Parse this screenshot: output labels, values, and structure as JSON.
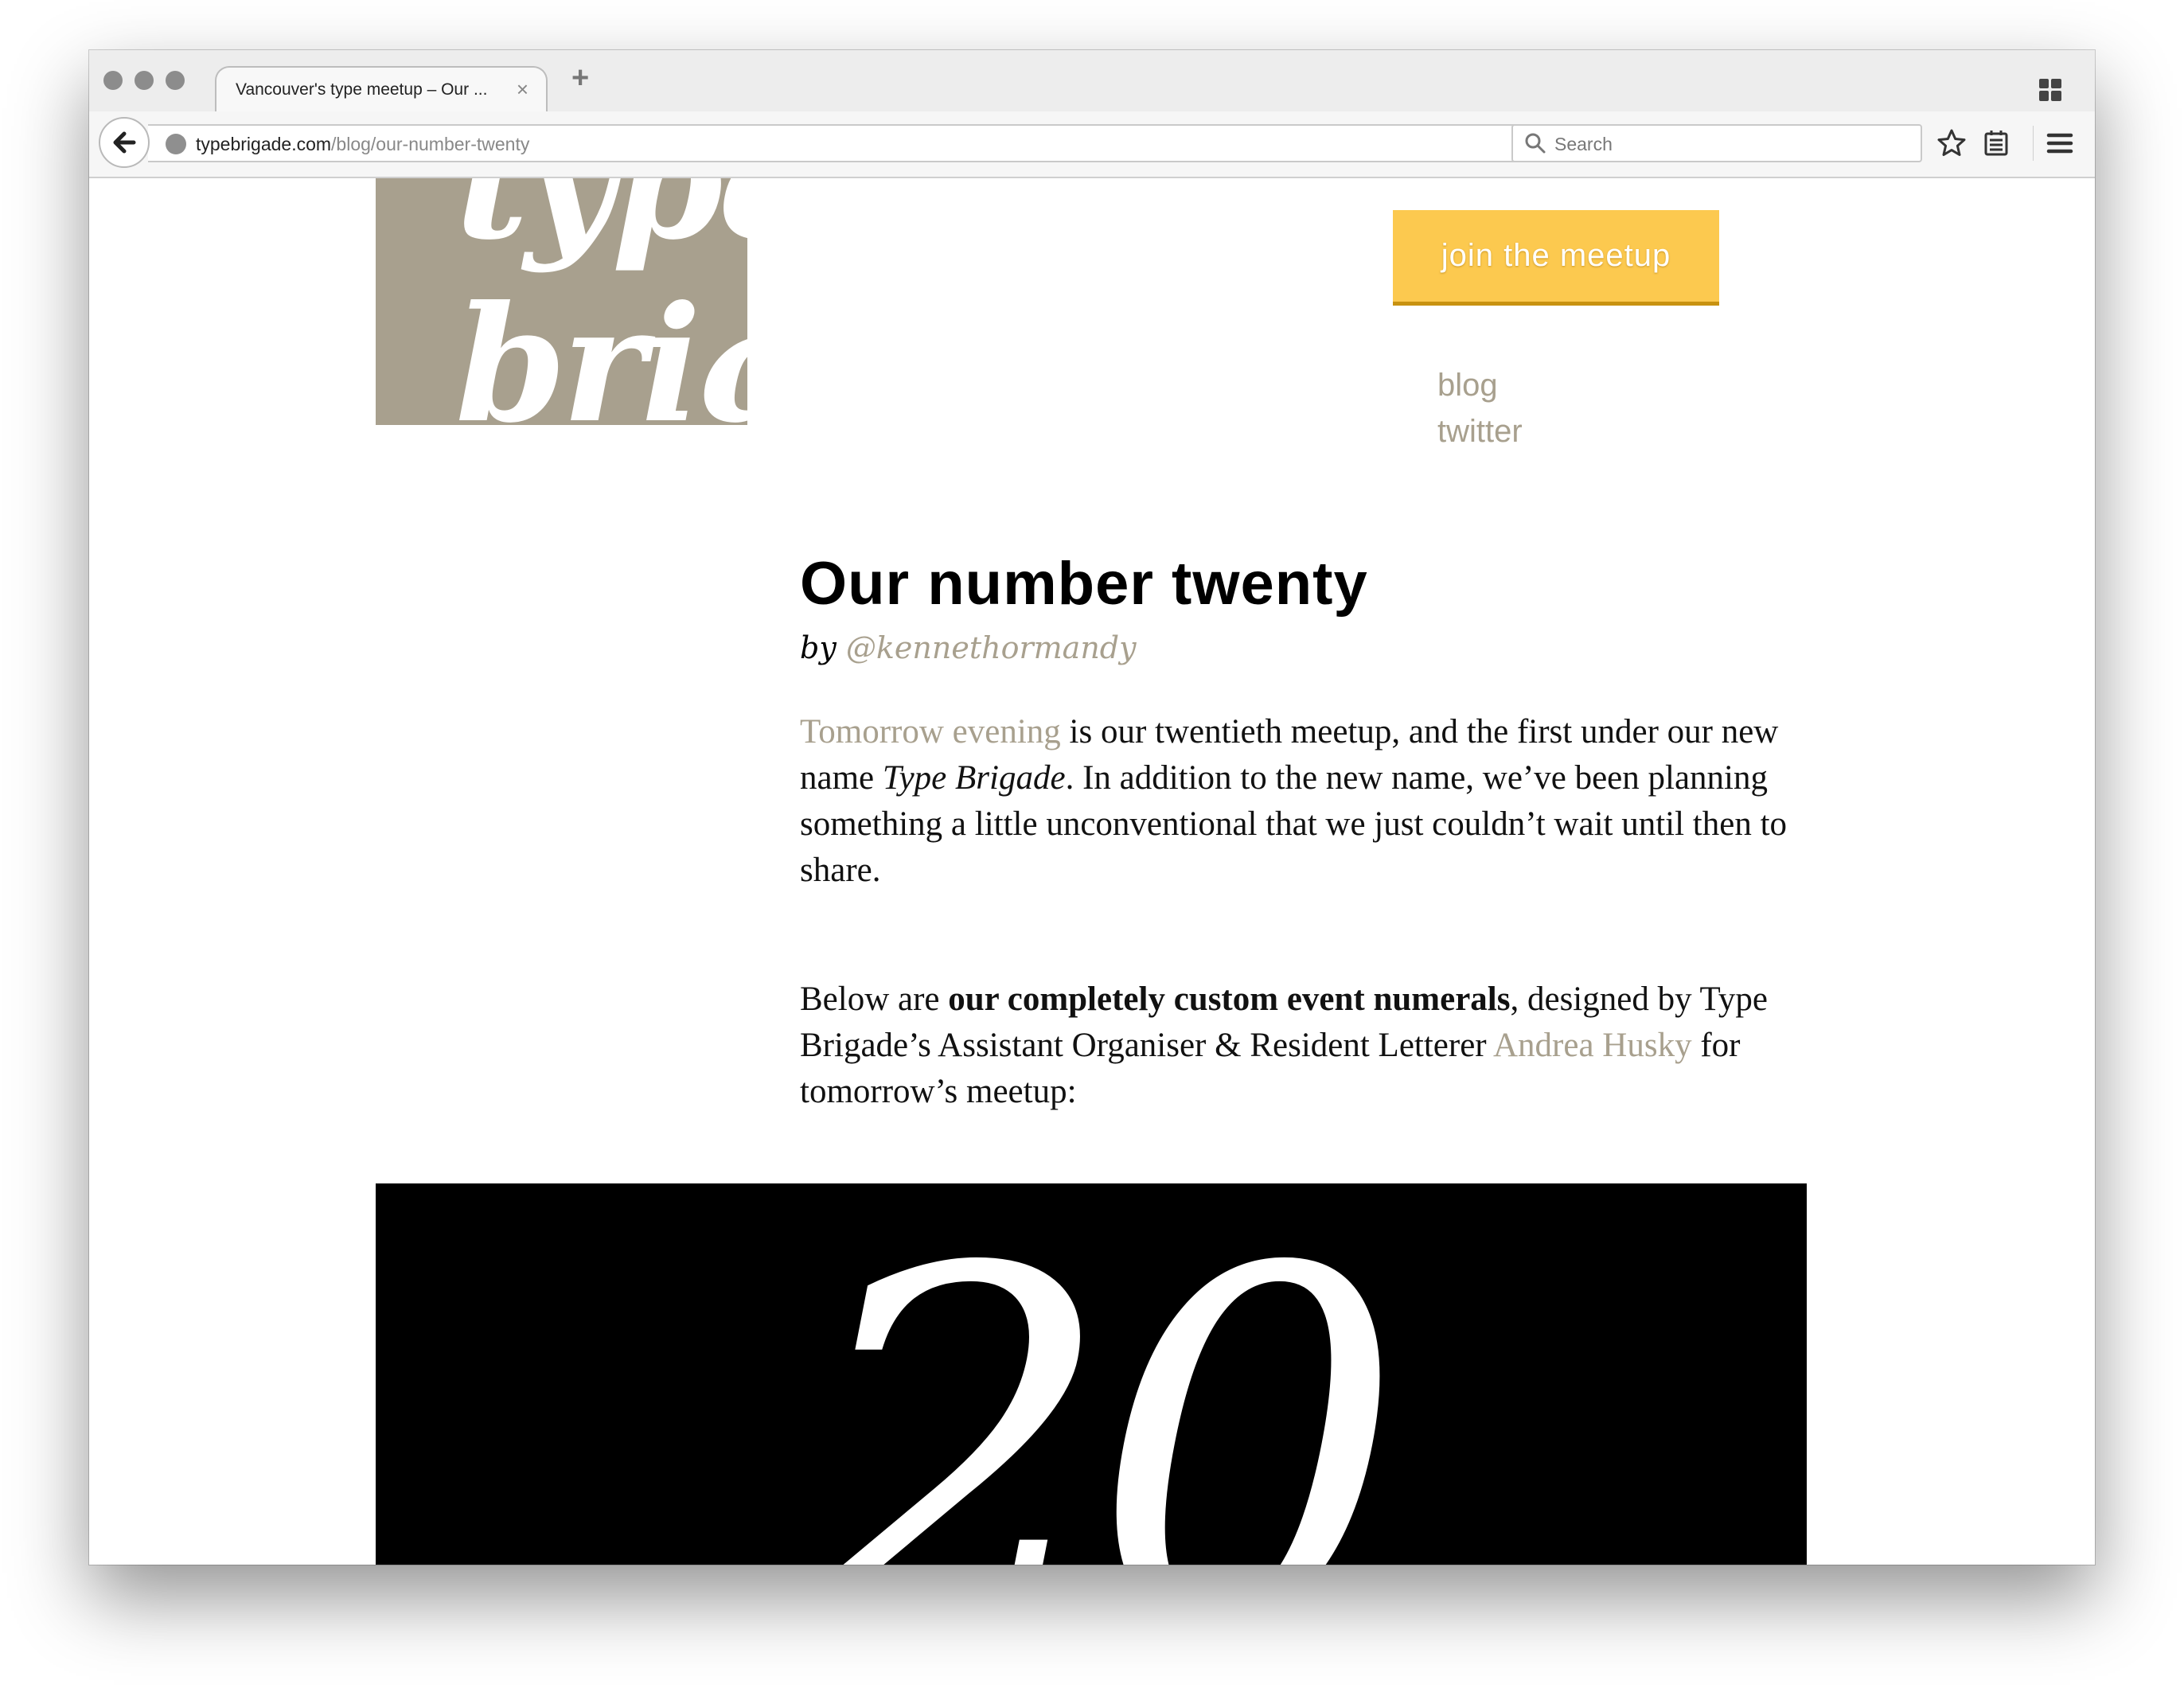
{
  "browser": {
    "tab_title": "Vancouver's type meetup – Our ...",
    "tab_close": "×",
    "new_tab": "+",
    "url_host": "typebrigade.com",
    "url_path": "/blog/our-number-twenty",
    "search_placeholder": "Search"
  },
  "site": {
    "logo_line1": "type",
    "logo_line2": "brig",
    "join_label": "join the meetup",
    "nav": [
      "blog",
      "twitter"
    ],
    "colors": {
      "accent": "#a8a08e",
      "button": "#fcc94f",
      "button_shadow": "#c89211"
    }
  },
  "article": {
    "title": "Our number twenty",
    "by_label": "by",
    "author": "@kennethormandy",
    "p1_link": "Tomorrow evening",
    "p1_a": " is our twentieth meetup, and the first under our new name ",
    "p1_em": "Type Brigade",
    "p1_b": ". In addition to the new name, we’ve been planning something a little unconventional that we just couldn’t wait until then to share.",
    "p2_a": "Below are ",
    "p2_strong": "our completely custom event numerals",
    "p2_b": ", designed by Type Brigade’s Assistant Organiser & Resident Letterer ",
    "p2_link": "Andrea Husky",
    "p2_c": " for tomorrow’s meetup:",
    "hero_numeral": "20"
  }
}
